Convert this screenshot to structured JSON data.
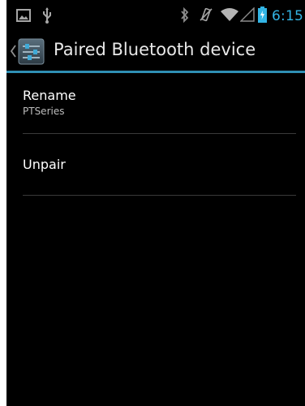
{
  "status_bar": {
    "time": "6:15",
    "icons": [
      "picture-icon",
      "usb-icon",
      "bluetooth-icon",
      "vibrate-icon",
      "wifi-icon",
      "signal-icon",
      "battery-charging-icon"
    ],
    "accent": "#33b5e5"
  },
  "action_bar": {
    "title": "Paired Bluetooth device",
    "icon": "settings-icon",
    "divider_color": "#2f8fb4"
  },
  "list": {
    "rename": {
      "label": "Rename",
      "value": "PTSeries"
    },
    "unpair": {
      "label": "Unpair"
    }
  },
  "colors": {
    "background": "#000000",
    "text_primary": "#ffffff",
    "text_secondary": "#bdbdbd"
  }
}
